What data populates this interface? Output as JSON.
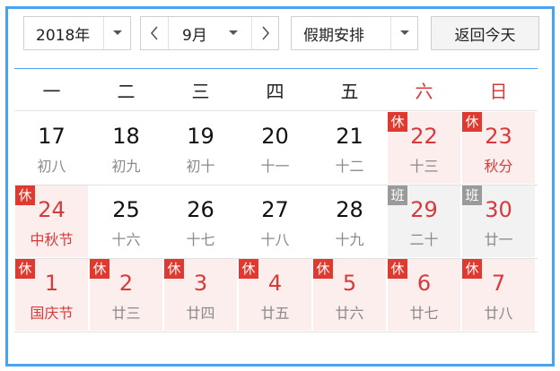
{
  "toolbar": {
    "year": "2018年",
    "month": "9月",
    "holiday": "假期安排",
    "today": "返回今天",
    "prev": "‹",
    "next": "›"
  },
  "weekdays": [
    "一",
    "二",
    "三",
    "四",
    "五",
    "六",
    "日"
  ],
  "badge_rest": "休",
  "badge_work": "班",
  "colors": {
    "accent": "#4aa3ef",
    "holiday_red": "#d63a3a",
    "rest_bg": "#fdeeee",
    "work_bg": "#f2f2f2"
  },
  "weeks": [
    [
      {
        "day": "17",
        "lunar": "初八",
        "type": "normal"
      },
      {
        "day": "18",
        "lunar": "初九",
        "type": "normal"
      },
      {
        "day": "19",
        "lunar": "初十",
        "type": "normal"
      },
      {
        "day": "20",
        "lunar": "十一",
        "type": "normal"
      },
      {
        "day": "21",
        "lunar": "十二",
        "type": "normal"
      },
      {
        "day": "22",
        "lunar": "十三",
        "type": "rest"
      },
      {
        "day": "23",
        "lunar": "秋分",
        "type": "rest",
        "festival": true
      }
    ],
    [
      {
        "day": "24",
        "lunar": "中秋节",
        "type": "rest",
        "festival": true
      },
      {
        "day": "25",
        "lunar": "十六",
        "type": "normal"
      },
      {
        "day": "26",
        "lunar": "十七",
        "type": "normal"
      },
      {
        "day": "27",
        "lunar": "十八",
        "type": "normal"
      },
      {
        "day": "28",
        "lunar": "十九",
        "type": "normal"
      },
      {
        "day": "29",
        "lunar": "二十",
        "type": "work"
      },
      {
        "day": "30",
        "lunar": "廿一",
        "type": "work"
      }
    ],
    [
      {
        "day": "1",
        "lunar": "国庆节",
        "type": "rest",
        "festival": true
      },
      {
        "day": "2",
        "lunar": "廿三",
        "type": "rest"
      },
      {
        "day": "3",
        "lunar": "廿四",
        "type": "rest"
      },
      {
        "day": "4",
        "lunar": "廿五",
        "type": "rest"
      },
      {
        "day": "5",
        "lunar": "廿六",
        "type": "rest"
      },
      {
        "day": "6",
        "lunar": "廿七",
        "type": "rest"
      },
      {
        "day": "7",
        "lunar": "廿八",
        "type": "rest"
      }
    ]
  ]
}
